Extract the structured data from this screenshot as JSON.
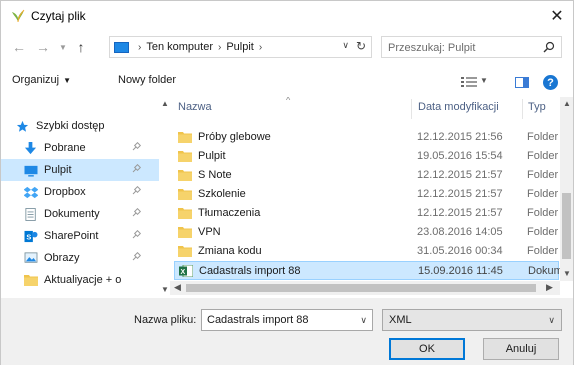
{
  "window": {
    "title": "Czytaj plik"
  },
  "address": {
    "crumbs": [
      "Ten komputer",
      "Pulpit"
    ]
  },
  "search": {
    "placeholder": "Przeszukaj: Pulpit"
  },
  "toolbar": {
    "organize": "Organizuj",
    "new_folder": "Nowy folder",
    "help": "?"
  },
  "nav": {
    "items": [
      {
        "label": "Szybki dostęp",
        "icon": "star-icon"
      },
      {
        "label": "Pobrane",
        "icon": "download-icon",
        "pinned": true
      },
      {
        "label": "Pulpit",
        "icon": "desktop-icon",
        "pinned": true,
        "selected": true
      },
      {
        "label": "Dropbox",
        "icon": "dropbox-icon",
        "pinned": true
      },
      {
        "label": "Dokumenty",
        "icon": "documents-icon",
        "pinned": true
      },
      {
        "label": "SharePoint",
        "icon": "sharepoint-icon",
        "pinned": true
      },
      {
        "label": "Obrazy",
        "icon": "pictures-icon",
        "pinned": true
      },
      {
        "label": "Aktualiyacje + o",
        "icon": "folder-icon"
      }
    ]
  },
  "columns": {
    "name": "Nazwa",
    "date": "Data modyfikacji",
    "type": "Typ"
  },
  "files": [
    {
      "name": "Próby glebowe",
      "date": "12.12.2015 21:56",
      "type": "Folder",
      "icon": "folder-icon"
    },
    {
      "name": "Pulpit",
      "date": "19.05.2016 15:54",
      "type": "Folder",
      "icon": "folder-icon"
    },
    {
      "name": "S Note",
      "date": "12.12.2015 21:57",
      "type": "Folder",
      "icon": "folder-icon"
    },
    {
      "name": "Szkolenie",
      "date": "12.12.2015 21:57",
      "type": "Folder",
      "icon": "folder-icon"
    },
    {
      "name": "Tłumaczenia",
      "date": "12.12.2015 21:57",
      "type": "Folder",
      "icon": "folder-icon"
    },
    {
      "name": "VPN",
      "date": "23.08.2016 14:05",
      "type": "Folder",
      "icon": "folder-icon"
    },
    {
      "name": "Zmiana kodu",
      "date": "31.05.2016 00:34",
      "type": "Folder",
      "icon": "folder-icon"
    },
    {
      "name": "Cadastrals import 88",
      "date": "15.09.2016 11:45",
      "type": "Dokument",
      "icon": "excel-icon",
      "selected": true
    }
  ],
  "footer": {
    "filename_label": "Nazwa pliku:",
    "filename_value": "Cadastrals import 88",
    "filetype_value": "XML",
    "ok_label": "OK",
    "cancel_label": "Anuluj"
  },
  "colors": {
    "selection": "#cce8ff",
    "accent": "#0078d7",
    "folder": "#f0c44c"
  }
}
